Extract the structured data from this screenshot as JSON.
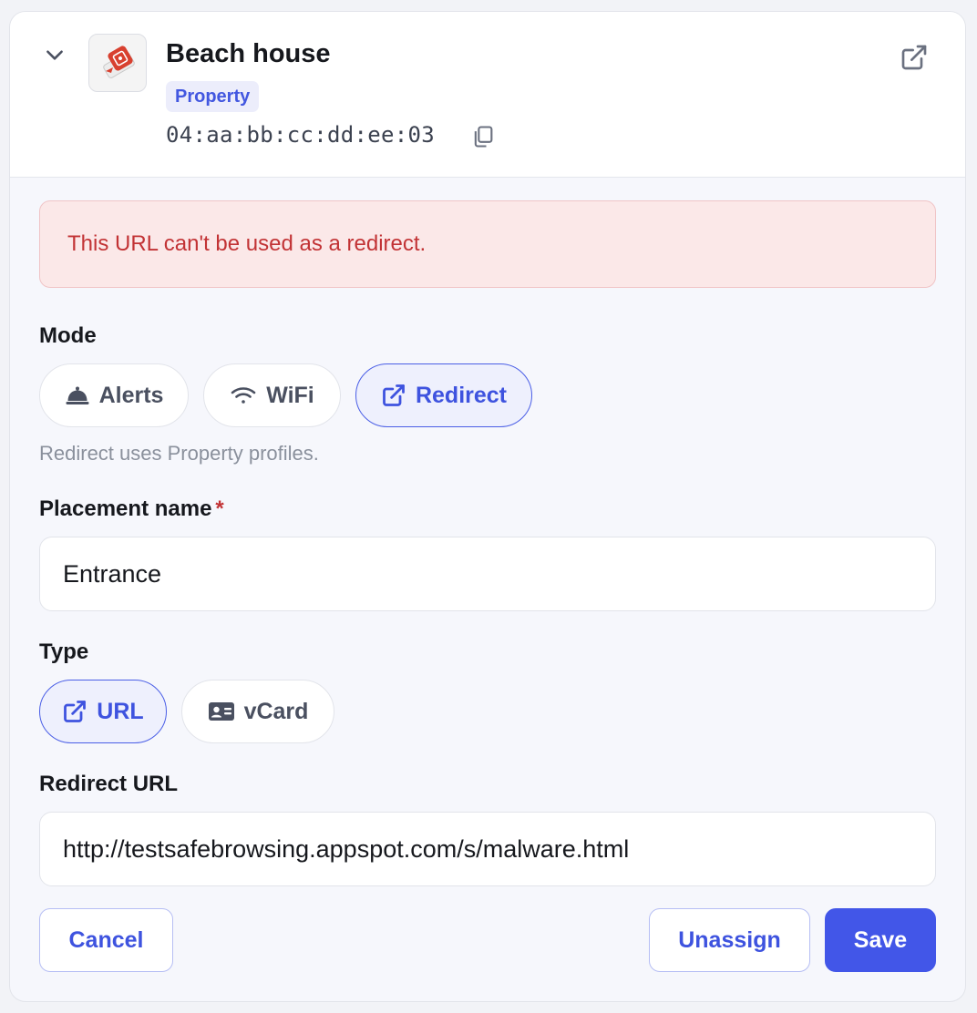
{
  "device": {
    "title": "Beach house",
    "badge": "Property",
    "mac": "04:aa:bb:cc:dd:ee:03"
  },
  "alert": {
    "message": "This URL can't be used as a redirect."
  },
  "mode": {
    "label": "Mode",
    "options": [
      {
        "label": "Alerts",
        "icon": "bell-icon",
        "selected": false
      },
      {
        "label": "WiFi",
        "icon": "wifi-icon",
        "selected": false
      },
      {
        "label": "Redirect",
        "icon": "external-link-icon",
        "selected": true
      }
    ],
    "hint": "Redirect uses Property profiles."
  },
  "placement": {
    "label": "Placement name",
    "required_mark": "*",
    "value": "Entrance"
  },
  "type": {
    "label": "Type",
    "options": [
      {
        "label": "URL",
        "icon": "external-link-icon",
        "selected": true
      },
      {
        "label": "vCard",
        "icon": "id-card-icon",
        "selected": false
      }
    ]
  },
  "redirect": {
    "label": "Redirect URL",
    "value": "http://testsafebrowsing.appspot.com/s/malware.html"
  },
  "actions": {
    "cancel": "Cancel",
    "unassign": "Unassign",
    "save": "Save"
  },
  "colors": {
    "accent": "#4256e8",
    "error": "#c23335",
    "error_bg": "#fbe8e8"
  }
}
